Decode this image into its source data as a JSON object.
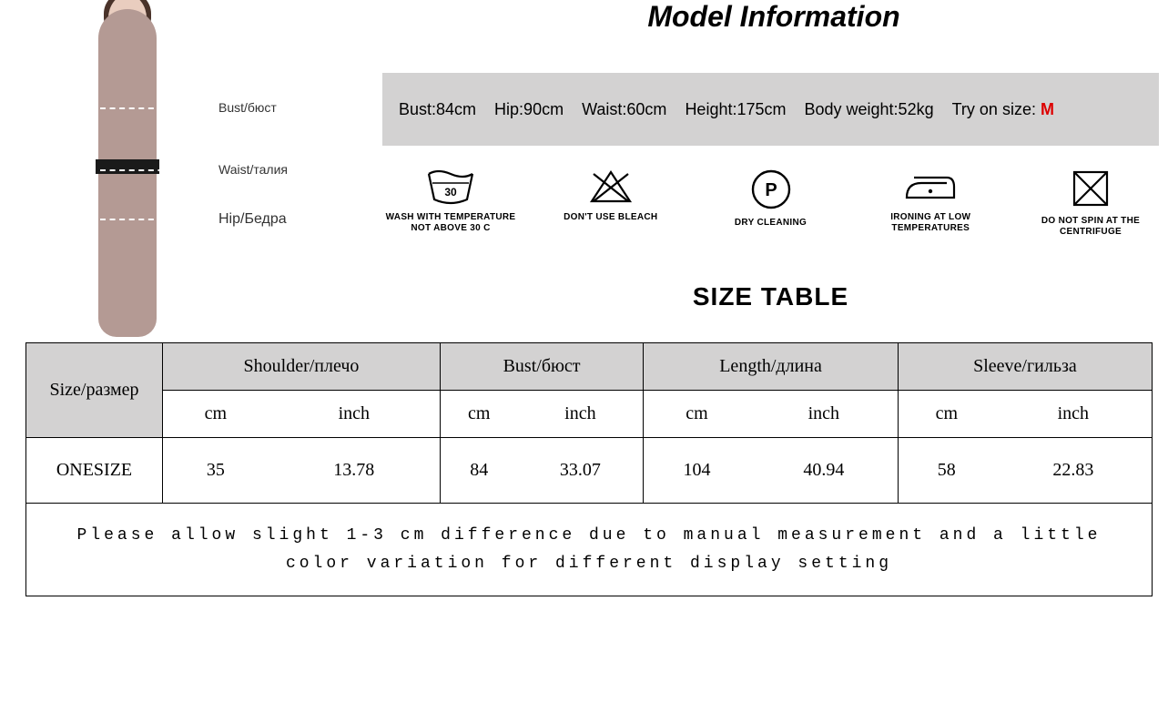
{
  "title": "Model Information",
  "modelDiagram": {
    "bust": "Bust/бюст",
    "waist": "Waist/талия",
    "hip": "Hip/Бедра"
  },
  "modelInfo": {
    "bust": "Bust:84cm",
    "hip": "Hip:90cm",
    "waist": "Waist:60cm",
    "height": "Height:175cm",
    "weight": "Body weight:52kg",
    "tryOnPrefix": "Try on size: ",
    "tryOnValue": "M"
  },
  "care": {
    "wash": "WASH WITH TEMPERATURE NOT ABOVE 30 C",
    "washNum": "30",
    "bleach": "DON'T USE BLEACH",
    "dry": "DRY CLEANING",
    "dryLetter": "P",
    "iron": "IRONING AT LOW TEMPERATURES",
    "spin": "DO NOT SPIN AT THE CENTRIFUGE"
  },
  "sizeTableTitle": "SIZE TABLE",
  "headers": {
    "size": "Size/размер",
    "shoulder": "Shoulder/плечо",
    "bust": "Bust/бюст",
    "length": "Length/длина",
    "sleeve": "Sleeve/гильза",
    "cm": "cm",
    "inch": "inch"
  },
  "row": {
    "size": "ONESIZE",
    "shoulder_cm": "35",
    "shoulder_in": "13.78",
    "bust_cm": "84",
    "bust_in": "33.07",
    "length_cm": "104",
    "length_in": "40.94",
    "sleeve_cm": "58",
    "sleeve_in": "22.83"
  },
  "footer": "Please allow slight 1-3 cm difference due to manual measurement and a little color variation for different display setting"
}
